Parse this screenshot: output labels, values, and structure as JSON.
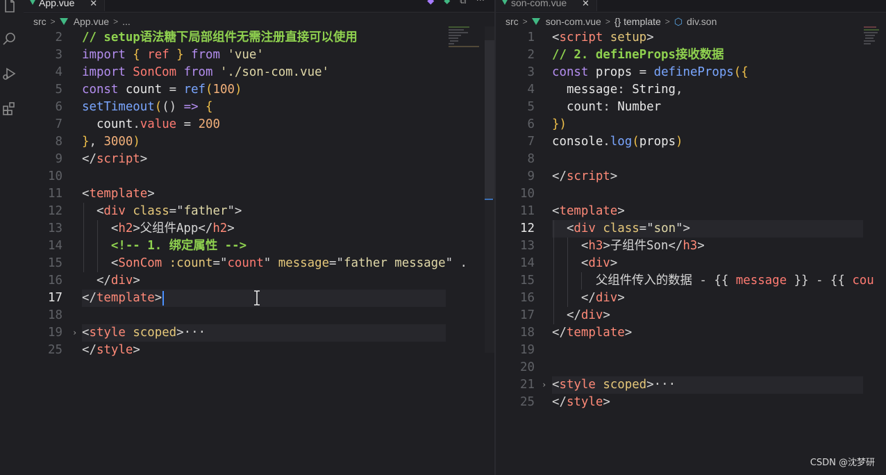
{
  "left_editor": {
    "tab": {
      "title": "App.vue",
      "close": "✕"
    },
    "actions": [
      "◆",
      "⬥",
      "⧉",
      "···"
    ],
    "breadcrumb": [
      "src",
      "App.vue",
      "..."
    ],
    "lines": [
      {
        "n": "2",
        "segs": [
          [
            "c-com",
            "// setup语法糖下局部组件无需注册直接可以使用"
          ]
        ]
      },
      {
        "n": "3",
        "segs": [
          [
            "c-kw",
            "import "
          ],
          [
            "c-brk",
            "{ "
          ],
          [
            "c-var",
            "ref"
          ],
          [
            "c-brk",
            " }"
          ],
          [
            "c-kw",
            " from "
          ],
          [
            "c-str",
            "'vue'"
          ]
        ]
      },
      {
        "n": "4",
        "segs": [
          [
            "c-kw",
            "import "
          ],
          [
            "c-var",
            "SonCom"
          ],
          [
            "c-kw",
            " from "
          ],
          [
            "c-str",
            "'./son-com.vue'"
          ]
        ]
      },
      {
        "n": "5",
        "segs": [
          [
            "c-kw",
            "const "
          ],
          [
            "c-cn",
            "count"
          ],
          [
            "c-pun",
            " = "
          ],
          [
            "c-fn",
            "ref"
          ],
          [
            "c-brk",
            "("
          ],
          [
            "c-num",
            "100"
          ],
          [
            "c-brk",
            ")"
          ]
        ]
      },
      {
        "n": "6",
        "segs": [
          [
            "c-fn",
            "setTimeout"
          ],
          [
            "c-brk",
            "("
          ],
          [
            "c-pun",
            "() "
          ],
          [
            "c-kw",
            "=>"
          ],
          [
            "c-pun",
            " "
          ],
          [
            "c-brk",
            "{"
          ]
        ]
      },
      {
        "n": "7",
        "segs": [
          [
            "c-pun",
            "  "
          ],
          [
            "c-cn",
            "count"
          ],
          [
            "c-pun",
            "."
          ],
          [
            "c-var",
            "value"
          ],
          [
            "c-pun",
            " = "
          ],
          [
            "c-num",
            "200"
          ]
        ]
      },
      {
        "n": "8",
        "segs": [
          [
            "c-brk",
            "}"
          ],
          [
            "c-pun",
            ", "
          ],
          [
            "c-num",
            "3000"
          ],
          [
            "c-brk",
            ")"
          ]
        ]
      },
      {
        "n": "9",
        "segs": [
          [
            "c-pun",
            "</"
          ],
          [
            "c-tag",
            "script"
          ],
          [
            "c-pun",
            ">"
          ]
        ]
      },
      {
        "n": "10",
        "segs": []
      },
      {
        "n": "11",
        "segs": [
          [
            "c-pun",
            "<"
          ],
          [
            "c-tag",
            "template"
          ],
          [
            "c-pun",
            ">"
          ]
        ]
      },
      {
        "n": "12",
        "segs": [
          [
            "c-pun",
            "  <"
          ],
          [
            "c-tag",
            "div"
          ],
          [
            "c-attr",
            " class"
          ],
          [
            "c-pun",
            "=\""
          ],
          [
            "c-str",
            "father"
          ],
          [
            "c-pun",
            "\">"
          ]
        ]
      },
      {
        "n": "13",
        "segs": [
          [
            "c-pun",
            "    <"
          ],
          [
            "c-tag",
            "h2"
          ],
          [
            "c-pun",
            ">父组件App</"
          ],
          [
            "c-tag",
            "h2"
          ],
          [
            "c-pun",
            ">"
          ]
        ]
      },
      {
        "n": "14",
        "segs": [
          [
            "c-pun",
            "    "
          ],
          [
            "c-com",
            "<!-- 1. 绑定属性 -->"
          ]
        ]
      },
      {
        "n": "15",
        "segs": [
          [
            "c-pun",
            "    <"
          ],
          [
            "c-tag",
            "SonCom"
          ],
          [
            "c-attr",
            " :count"
          ],
          [
            "c-pun",
            "=\""
          ],
          [
            "c-var",
            "count"
          ],
          [
            "c-pun",
            "\""
          ],
          [
            "c-attr",
            " message"
          ],
          [
            "c-pun",
            "=\""
          ],
          [
            "c-str",
            "father message"
          ],
          [
            "c-pun",
            "\" ."
          ]
        ]
      },
      {
        "n": "16",
        "segs": [
          [
            "c-pun",
            "  </"
          ],
          [
            "c-tag",
            "div"
          ],
          [
            "c-pun",
            ">"
          ]
        ]
      },
      {
        "n": "17",
        "segs": [
          [
            "c-pun",
            "</"
          ],
          [
            "c-tag",
            "template"
          ],
          [
            "c-pun",
            ">"
          ]
        ],
        "active": true,
        "cursor": true
      },
      {
        "n": "18",
        "segs": []
      },
      {
        "n": "19",
        "segs": [
          [
            "c-pun",
            "<"
          ],
          [
            "c-tag",
            "style"
          ],
          [
            "c-attr",
            " scoped"
          ],
          [
            "c-pun",
            ">"
          ],
          [
            "c-pun",
            "···"
          ]
        ],
        "fold": true
      },
      {
        "n": "25",
        "segs": [
          [
            "c-pun",
            "</"
          ],
          [
            "c-tag",
            "style"
          ],
          [
            "c-pun",
            ">"
          ]
        ]
      }
    ]
  },
  "right_editor": {
    "tab": {
      "title": "son-com.vue",
      "close": "✕"
    },
    "breadcrumb": [
      "src",
      "son-com.vue",
      "{} template",
      "div.son"
    ],
    "lines": [
      {
        "n": "1",
        "segs": [
          [
            "c-pun",
            "<"
          ],
          [
            "c-tag",
            "script"
          ],
          [
            "c-attr",
            " setup"
          ],
          [
            "c-pun",
            ">"
          ]
        ]
      },
      {
        "n": "2",
        "segs": [
          [
            "c-com",
            "// 2. defineProps接收数据"
          ]
        ]
      },
      {
        "n": "3",
        "segs": [
          [
            "c-kw",
            "const "
          ],
          [
            "c-cn",
            "props"
          ],
          [
            "c-pun",
            " = "
          ],
          [
            "c-fn",
            "defineProps"
          ],
          [
            "c-brk",
            "({"
          ]
        ]
      },
      {
        "n": "4",
        "segs": [
          [
            "c-pun",
            "  "
          ],
          [
            "c-prop",
            "message"
          ],
          [
            "c-pun",
            ": "
          ],
          [
            "c-cn",
            "String"
          ],
          [
            "c-pun",
            ","
          ]
        ]
      },
      {
        "n": "5",
        "segs": [
          [
            "c-pun",
            "  "
          ],
          [
            "c-prop",
            "count"
          ],
          [
            "c-pun",
            ": "
          ],
          [
            "c-cn",
            "Number"
          ]
        ]
      },
      {
        "n": "6",
        "segs": [
          [
            "c-brk",
            "})"
          ]
        ]
      },
      {
        "n": "7",
        "segs": [
          [
            "c-cn",
            "console"
          ],
          [
            "c-pun",
            "."
          ],
          [
            "c-fn",
            "log"
          ],
          [
            "c-brk",
            "("
          ],
          [
            "c-cn",
            "props"
          ],
          [
            "c-brk",
            ")"
          ]
        ]
      },
      {
        "n": "8",
        "segs": []
      },
      {
        "n": "9",
        "segs": [
          [
            "c-pun",
            "</"
          ],
          [
            "c-tag",
            "script"
          ],
          [
            "c-pun",
            ">"
          ]
        ]
      },
      {
        "n": "10",
        "segs": []
      },
      {
        "n": "11",
        "segs": [
          [
            "c-pun",
            "<"
          ],
          [
            "c-tag",
            "template"
          ],
          [
            "c-pun",
            ">"
          ]
        ]
      },
      {
        "n": "12",
        "segs": [
          [
            "c-pun",
            "  <"
          ],
          [
            "c-tag",
            "div"
          ],
          [
            "c-attr",
            " class"
          ],
          [
            "c-pun",
            "=\""
          ],
          [
            "c-str",
            "son"
          ],
          [
            "c-pun",
            "\">"
          ]
        ],
        "active": true
      },
      {
        "n": "13",
        "segs": [
          [
            "c-pun",
            "    <"
          ],
          [
            "c-tag",
            "h3"
          ],
          [
            "c-pun",
            ">子组件Son</"
          ],
          [
            "c-tag",
            "h3"
          ],
          [
            "c-pun",
            ">"
          ]
        ]
      },
      {
        "n": "14",
        "segs": [
          [
            "c-pun",
            "    <"
          ],
          [
            "c-tag",
            "div"
          ],
          [
            "c-pun",
            ">"
          ]
        ]
      },
      {
        "n": "15",
        "segs": [
          [
            "c-pun",
            "      父组件传入的数据 - {{ "
          ],
          [
            "c-var",
            "message"
          ],
          [
            "c-pun",
            " }} - {{ "
          ],
          [
            "c-var",
            "cou"
          ]
        ]
      },
      {
        "n": "16",
        "segs": [
          [
            "c-pun",
            "    </"
          ],
          [
            "c-tag",
            "div"
          ],
          [
            "c-pun",
            ">"
          ]
        ]
      },
      {
        "n": "17",
        "segs": [
          [
            "c-pun",
            "  </"
          ],
          [
            "c-tag",
            "div"
          ],
          [
            "c-pun",
            ">"
          ]
        ]
      },
      {
        "n": "18",
        "segs": [
          [
            "c-pun",
            "</"
          ],
          [
            "c-tag",
            "template"
          ],
          [
            "c-pun",
            ">"
          ]
        ]
      },
      {
        "n": "19",
        "segs": []
      },
      {
        "n": "20",
        "segs": []
      },
      {
        "n": "21",
        "segs": [
          [
            "c-pun",
            "<"
          ],
          [
            "c-tag",
            "style"
          ],
          [
            "c-attr",
            " scoped"
          ],
          [
            "c-pun",
            ">"
          ],
          [
            "c-pun",
            "···"
          ]
        ],
        "fold": true
      },
      {
        "n": "25",
        "segs": [
          [
            "c-pun",
            "</"
          ],
          [
            "c-tag",
            "style"
          ],
          [
            "c-pun",
            ">"
          ]
        ]
      }
    ]
  },
  "activity_icons": [
    "files-icon",
    "search-icon",
    "run-debug-icon",
    "extensions-icon"
  ],
  "watermark": "CSDN @沈梦研"
}
